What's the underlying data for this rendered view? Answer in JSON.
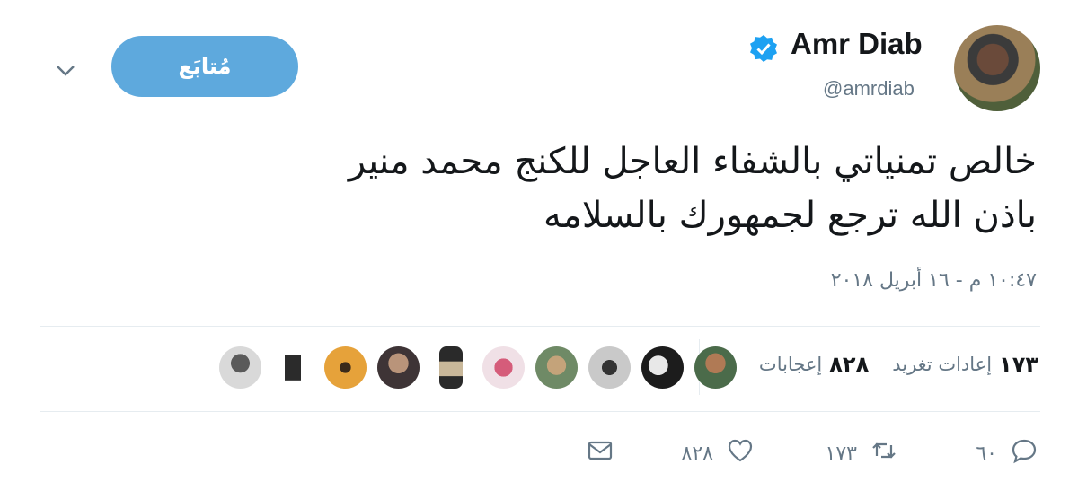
{
  "header": {
    "display_name": "Amr Diab",
    "handle": "@amrdiab",
    "follow_label": "مُتابَع",
    "verified": true
  },
  "tweet": {
    "text_line1": "خالص تمنياتي بالشفاء العاجل للكنج محمد منير",
    "text_line2": "باذن الله ترجع لجمهورك بالسلامه",
    "timestamp": "١٠:٤٧ م - ١٦ أبريل ٢٠١٨"
  },
  "stats": {
    "retweets_count": "١٧٣",
    "retweets_label": "إعادات تغريد",
    "likes_count": "٨٢٨",
    "likes_label": "إعجابات"
  },
  "likers": [
    "avatar-1",
    "avatar-2",
    "avatar-3",
    "avatar-4",
    "avatar-5",
    "avatar-6",
    "avatar-7",
    "avatar-8",
    "avatar-9"
  ],
  "actions": {
    "reply_count": "٦٠",
    "retweet_count": "١٧٣",
    "like_count": "٨٢٨"
  },
  "colors": {
    "accent": "#5ea9dd",
    "verified": "#1da1f2",
    "muted": "#657786",
    "divider": "#e6ecf0"
  }
}
